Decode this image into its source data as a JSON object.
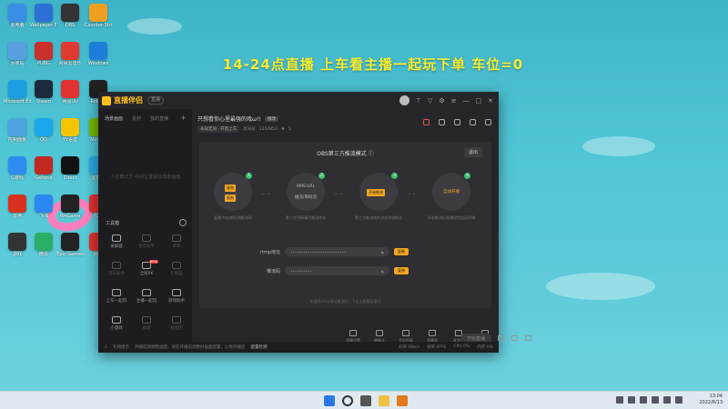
{
  "desktop": {
    "banner": "14-24点直播   上车看主播一起玩下单  车位=0",
    "icons": [
      {
        "label": "此电脑",
        "color": "#3a8ee6"
      },
      {
        "label": "Wallpaper Engine",
        "color": "#2c6fd6"
      },
      {
        "label": "OBS",
        "color": "#333333"
      },
      {
        "label": "Counter-Strike",
        "color": "#f0a020"
      },
      {
        "label": "回收站",
        "color": "#5aa0e0"
      },
      {
        "label": "PUBG",
        "color": "#c8302a"
      },
      {
        "label": "网易云音乐",
        "color": "#e03a2f"
      },
      {
        "label": "Windows",
        "color": "#1d7ed8"
      },
      {
        "label": "Microsoft Edge",
        "color": "#1b9de0"
      },
      {
        "label": "Steam",
        "color": "#1c2a3e"
      },
      {
        "label": "网易UU",
        "color": "#e0322f"
      },
      {
        "label": "Roblox",
        "color": "#222222"
      },
      {
        "label": "控制面板",
        "color": "#4da3e0"
      },
      {
        "label": "QQ",
        "color": "#1aa7ec"
      },
      {
        "label": "YY语音",
        "color": "#f5c400"
      },
      {
        "label": "NVIDIA",
        "color": "#76b900"
      },
      {
        "label": "G游戏",
        "color": "#2d8cf0"
      },
      {
        "label": "Geforce",
        "color": "#c12a20"
      },
      {
        "label": "Direct",
        "color": "#111111"
      },
      {
        "label": "爱加速",
        "color": "#2aa9e0"
      },
      {
        "label": "雷神",
        "color": "#d6321f"
      },
      {
        "label": "飞书",
        "color": "#2b88f2"
      },
      {
        "label": "WeGame",
        "color": "#222222"
      },
      {
        "label": "优酷",
        "color": "#e0322f"
      },
      {
        "label": "游戏",
        "color": "#333333"
      },
      {
        "label": "微信",
        "color": "#2aae67"
      },
      {
        "label": "Epic Games",
        "color": "#222222"
      },
      {
        "label": "网易",
        "color": "#e0322f"
      }
    ]
  },
  "app": {
    "name": "直播伴侣",
    "version": "直播",
    "sidebar": {
      "tabs": [
        "场景画面",
        "素材",
        "我的直播"
      ],
      "hint": "①在模式下 中间位置添加场景画面",
      "tools_title": "工具箱",
      "tools": [
        {
          "label": "录屏器",
          "dim": false
        },
        {
          "label": "语音助手",
          "dim": true
        },
        {
          "label": "手机",
          "dim": true
        },
        {
          "label": "音乐助手",
          "dim": true
        },
        {
          "label": "全民PK",
          "dim": false,
          "badge": "NEW"
        },
        {
          "label": "礼物盒",
          "dim": true
        },
        {
          "label": "上车一起玩",
          "dim": false
        },
        {
          "label": "主播一起玩",
          "dim": false
        },
        {
          "label": "游戏助手",
          "dim": false
        },
        {
          "label": "小游戏",
          "dim": false
        },
        {
          "label": "福袋",
          "dim": true
        },
        {
          "label": "粉丝团",
          "dim": true
        }
      ]
    },
    "room": {
      "title": "只想看你心里最强的戏ω!!",
      "tag": "修改",
      "category": "永劫无间 · 开黑上车",
      "room_id_label": "房间号",
      "room_id": "1254853",
      "fans": "5"
    },
    "stage": {
      "mode_title": "OBS第三方推流模式",
      "exit_label": "退出",
      "steps": [
        {
          "num": "1",
          "buttons": [
            "复制",
            "复制"
          ],
          "label": "复制rtmp地址和推流码"
        },
        {
          "num": "2",
          "lines": [
            "RMS URL",
            "推流/串码流"
          ],
          "label": "第三方OBS填写推流地址"
        },
        {
          "num": "3",
          "button": "开始推流",
          "label": "第三方推流软件点击开始推流"
        },
        {
          "num": "4",
          "text": "自动开播",
          "label": "开启推流后直播伴侣自动开播"
        }
      ],
      "fields": [
        {
          "label": "rtmp地址",
          "value": "••••••••••••••••••••••••••",
          "copy": "复制"
        },
        {
          "label": "推流码",
          "value": "••••••••••",
          "copy": "复制"
        }
      ],
      "note": "未使用rtmp地址推流时，下次无需重复填写"
    },
    "bottom_tools": [
      "直播设置",
      "摄像头",
      "手机投屏",
      "直播间",
      "麦克风",
      "扬声器"
    ],
    "start_label": "开始直播",
    "statusbar": {
      "warning": "礼物提示",
      "text": "开播前请调整画面，请在开播前调整好画面配置，以免开播后",
      "link": "配置检测",
      "stats": [
        "码率:0kb/s",
        "帧率:0FPS",
        "CPU:0%",
        "内存:0%"
      ]
    }
  },
  "taskbar": {
    "time": "13:04",
    "date": "2022/8/13"
  }
}
